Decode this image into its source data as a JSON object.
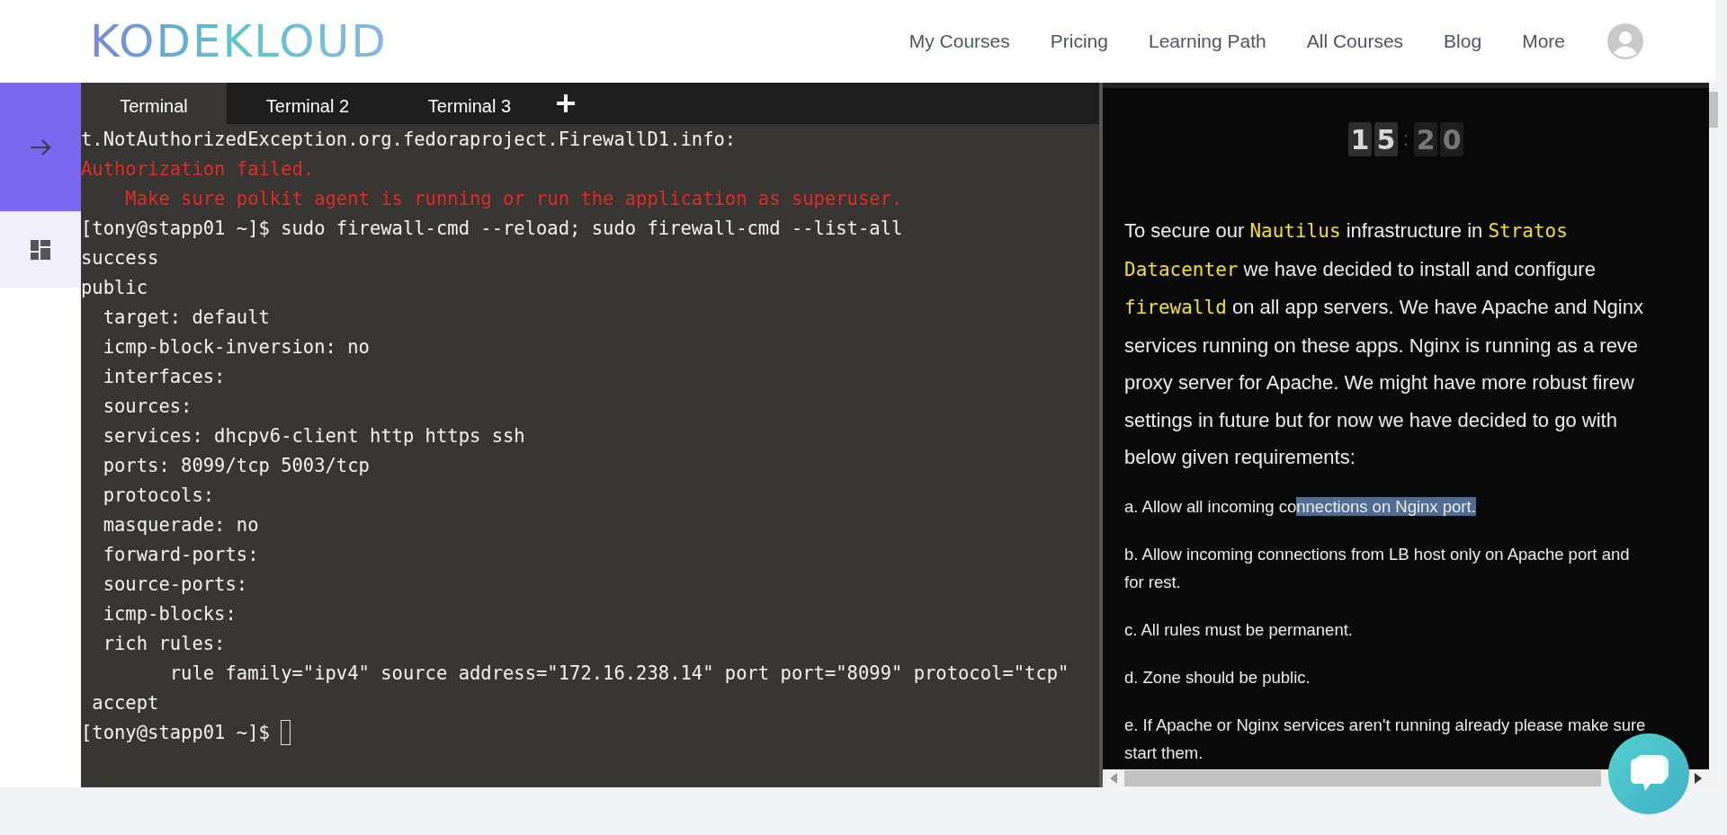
{
  "header": {
    "logo": "KODEKLOUD",
    "nav": [
      "My Courses",
      "Pricing",
      "Learning Path",
      "All Courses",
      "Blog",
      "More"
    ]
  },
  "sidebar": {
    "items": [
      {
        "kind": "arrow",
        "selected": true
      },
      {
        "kind": "dashboard",
        "selected": false
      }
    ]
  },
  "tabs": [
    {
      "label": "Terminal",
      "selected": true
    },
    {
      "label": "Terminal 2",
      "selected": false
    },
    {
      "label": "Terminal 3",
      "selected": false
    }
  ],
  "terminal": {
    "lines": [
      {
        "kind": "output",
        "text": "t.NotAuthorizedException.org.fedoraproject.FirewallD1.info:"
      },
      {
        "kind": "error",
        "text": "Authorization failed."
      },
      {
        "kind": "error",
        "text": "    Make sure polkit agent is running or run the application as superuser."
      },
      {
        "kind": "output",
        "text": "[tony@stapp01 ~]$ sudo firewall-cmd --reload; sudo firewall-cmd --list-all"
      },
      {
        "kind": "output",
        "text": "success"
      },
      {
        "kind": "output",
        "text": "public"
      },
      {
        "kind": "output",
        "text": "  target: default"
      },
      {
        "kind": "output",
        "text": "  icmp-block-inversion: no"
      },
      {
        "kind": "output",
        "text": "  interfaces: "
      },
      {
        "kind": "output",
        "text": "  sources: "
      },
      {
        "kind": "output",
        "text": "  services: dhcpv6-client http https ssh"
      },
      {
        "kind": "output",
        "text": "  ports: 8099/tcp 5003/tcp"
      },
      {
        "kind": "output",
        "text": "  protocols: "
      },
      {
        "kind": "output",
        "text": "  masquerade: no"
      },
      {
        "kind": "output",
        "text": "  forward-ports: "
      },
      {
        "kind": "output",
        "text": "  source-ports: "
      },
      {
        "kind": "output",
        "text": "  icmp-blocks: "
      },
      {
        "kind": "output",
        "text": "  rich rules: "
      },
      {
        "kind": "output",
        "text": "        rule family=\"ipv4\" source address=\"172.16.238.14\" port port=\"8099\" protocol=\"tcp\""
      },
      {
        "kind": "output",
        "text": " accept"
      },
      {
        "kind": "prompt",
        "text": "[tony@stapp01 ~]$ "
      }
    ]
  },
  "task": {
    "clock": {
      "hours": [
        "1",
        "5"
      ],
      "separator": ":",
      "minutes": [
        "2",
        "0"
      ]
    },
    "intro": [
      [
        {
          "kind": "plain",
          "text": "To secure our "
        },
        {
          "kind": "code",
          "text": "Nautilus"
        },
        {
          "kind": "plain",
          "text": " infrastructure in "
        },
        {
          "kind": "code",
          "text": "Stratos"
        }
      ],
      [
        {
          "kind": "code",
          "text": "Datacenter"
        },
        {
          "kind": "plain",
          "text": " we have decided to install and configure"
        }
      ],
      [
        {
          "kind": "code",
          "text": "firewalld"
        },
        {
          "kind": "plain",
          "text": " on all app servers. We have Apache and Nginx"
        }
      ],
      [
        {
          "kind": "plain",
          "text": "services running on these apps. Nginx is running as a reve"
        }
      ],
      [
        {
          "kind": "plain",
          "text": "proxy server for Apache. We might have more robust firew"
        }
      ],
      [
        {
          "kind": "plain",
          "text": "settings in future but for now we have decided to go with"
        }
      ],
      [
        {
          "kind": "plain",
          "text": "below given requirements:"
        }
      ]
    ],
    "requirements": [
      {
        "lines": [
          "a. Allow all incoming co"
        ],
        "selected_text": "nnections on Nginx port."
      },
      {
        "lines": [
          "b. Allow incoming connections from LB host only on Apache port and",
          "for rest."
        ]
      },
      {
        "lines": [
          "c. All rules must be permanent."
        ]
      },
      {
        "lines": [
          "d. Zone should be public."
        ]
      },
      {
        "lines": [
          "e. If Apache or Nginx services aren't running already please make sure",
          "start them."
        ]
      }
    ]
  }
}
